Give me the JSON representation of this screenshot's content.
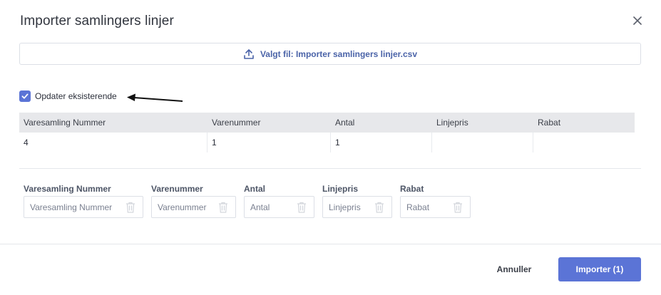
{
  "dialog": {
    "title": "Importer samlingers linjer",
    "close_icon": "close-icon"
  },
  "file": {
    "icon": "upload-icon",
    "label": "Valgt fil: Importer samlingers linjer.csv"
  },
  "options": {
    "update_existing": {
      "label": "Opdater eksisterende",
      "checked": true
    }
  },
  "preview_table": {
    "headers": [
      "Varesamling Nummer",
      "Varenummer",
      "Antal",
      "Linjepris",
      "Rabat"
    ],
    "rows": [
      [
        "4",
        "1",
        "1",
        "",
        ""
      ]
    ]
  },
  "mapping": {
    "fields": [
      {
        "label": "Varesamling Nummer",
        "placeholder": "Varesamling Nummer"
      },
      {
        "label": "Varenummer",
        "placeholder": "Varenummer"
      },
      {
        "label": "Antal",
        "placeholder": "Antal"
      },
      {
        "label": "Linjepris",
        "placeholder": "Linjepris"
      },
      {
        "label": "Rabat",
        "placeholder": "Rabat"
      }
    ]
  },
  "footer": {
    "cancel_label": "Annuller",
    "import_label": "Importer (1)"
  },
  "colors": {
    "accent": "#5b74d6",
    "link": "#4a63a8",
    "header_bg": "#e7e8eb"
  }
}
